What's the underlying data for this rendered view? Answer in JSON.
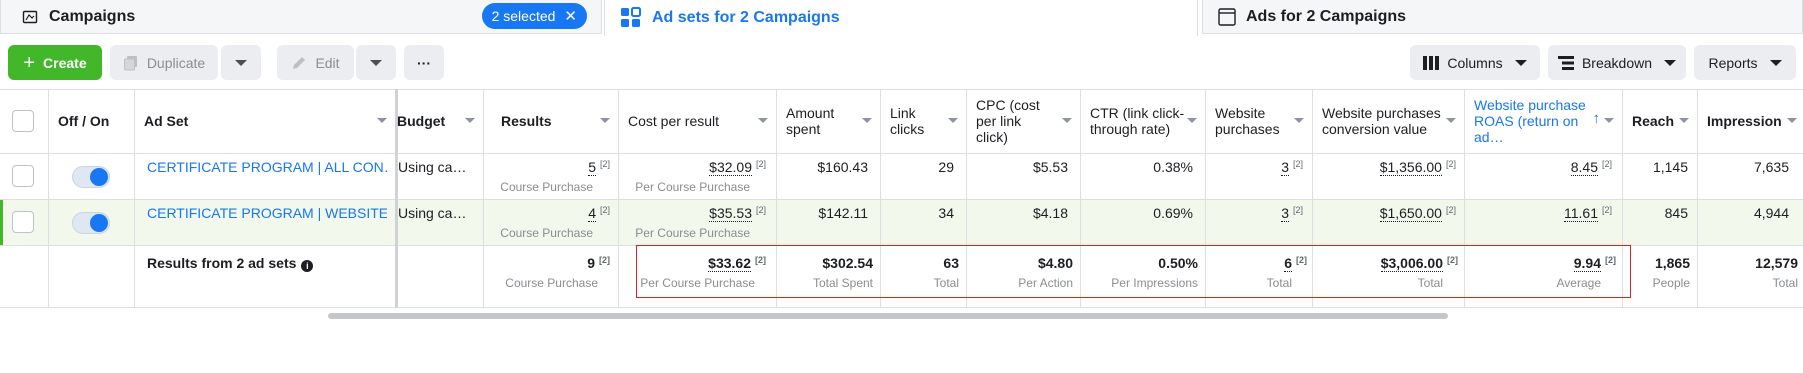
{
  "tabs": {
    "campaigns": {
      "label": "Campaigns",
      "selected_badge": "2 selected",
      "icon": "folder-icon"
    },
    "ad_sets": {
      "label": "Ad sets for 2 Campaigns",
      "icon": "grid-icon",
      "active": true
    },
    "ads": {
      "label": "Ads for 2 Campaigns",
      "icon": "ad-frame-icon"
    }
  },
  "toolbar": {
    "create_label": "Create",
    "duplicate_label": "Duplicate",
    "edit_label": "Edit",
    "more_label": "···",
    "columns_label": "Columns",
    "breakdown_label": "Breakdown",
    "reports_label": "Reports"
  },
  "colors": {
    "accent": "#1877f2",
    "create": "#42b72a",
    "highlight_border": "#e02020",
    "selected_row": "#f2f8ec"
  },
  "table": {
    "headers": {
      "off_on": "Off / On",
      "ad_set": "Ad Set",
      "budget": "Budget",
      "results": "Results",
      "cost_per_result": "Cost per result",
      "amount_spent": "Amount spent",
      "link_clicks": "Link clicks",
      "cpc": "CPC (cost per link click)",
      "ctr": "CTR (link click-through rate)",
      "website_purchases": "Website purchases",
      "conversion_value": "Website purchases conversion value",
      "roas": "Website purchase ROAS (return on ad…",
      "reach": "Reach",
      "impressions": "Impression"
    },
    "rows": [
      {
        "name": "CERTIFICATE PROGRAM | ALL CON…",
        "budget": "Using ca…",
        "results": "5",
        "results_sub": "Course Purchase",
        "cost_per_result": "$32.09",
        "cost_sub": "Per Course Purchase",
        "amount_spent": "$160.43",
        "link_clicks": "29",
        "cpc": "$5.53",
        "ctr": "0.38%",
        "website_purchases": "3",
        "conversion_value": "$1,356.00",
        "roas": "8.45",
        "reach": "1,145",
        "impressions": "7,635",
        "on": true
      },
      {
        "name": "CERTIFICATE PROGRAM | WEBSITE …",
        "budget": "Using ca…",
        "results": "4",
        "results_sub": "Course Purchase",
        "cost_per_result": "$35.53",
        "cost_sub": "Per Course Purchase",
        "amount_spent": "$142.11",
        "link_clicks": "34",
        "cpc": "$4.18",
        "ctr": "0.69%",
        "website_purchases": "3",
        "conversion_value": "$1,650.00",
        "roas": "11.61",
        "reach": "845",
        "impressions": "4,944",
        "on": true
      }
    ],
    "footnote_marker": "[2]",
    "totals": {
      "label": "Results from 2 ad sets",
      "info_icon": "i",
      "results": "9",
      "results_sub": "Course Purchase",
      "cost_per_result": "$33.62",
      "cost_sub": "Per Course Purchase",
      "amount_spent": "$302.54",
      "amount_sub": "Total Spent",
      "link_clicks": "63",
      "link_clicks_sub": "Total",
      "cpc": "$4.80",
      "cpc_sub": "Per Action",
      "ctr": "0.50%",
      "ctr_sub": "Per Impressions",
      "website_purchases": "6",
      "website_purchases_sub": "Total",
      "conversion_value": "$3,006.00",
      "conversion_value_sub": "Total",
      "roas": "9.94",
      "roas_sub": "Average",
      "reach": "1,865",
      "reach_sub": "People",
      "impressions": "12,579",
      "impressions_sub": "Total"
    }
  }
}
